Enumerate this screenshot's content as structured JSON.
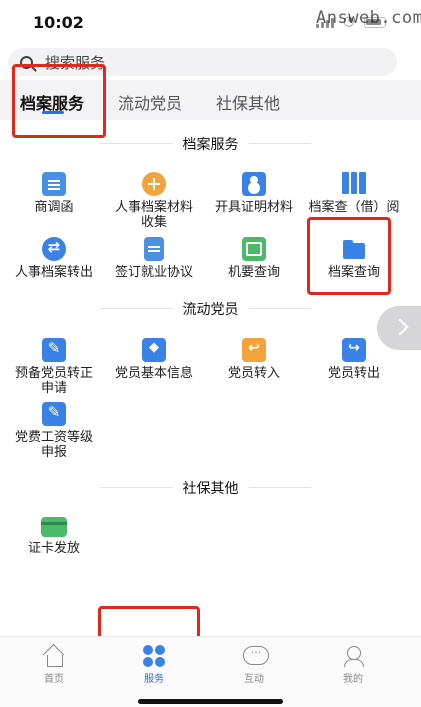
{
  "status_bar": {
    "time": "10:02"
  },
  "watermark": "Answeb.com",
  "search": {
    "placeholder": "搜索服务"
  },
  "tabs": [
    {
      "label": "档案服务",
      "active": true
    },
    {
      "label": "流动党员",
      "active": false
    },
    {
      "label": "社保其他",
      "active": false
    }
  ],
  "sections": [
    {
      "title": "档案服务",
      "items": [
        {
          "label": "商调函",
          "icon": "document-icon"
        },
        {
          "label": "人事档案材料收集",
          "icon": "plus-circle-icon"
        },
        {
          "label": "开具证明材料",
          "icon": "person-card-icon"
        },
        {
          "label": "档案查（借）阅",
          "icon": "file-cabinet-icon"
        },
        {
          "label": "人事档案转出",
          "icon": "transfer-icon"
        },
        {
          "label": "签订就业协议",
          "icon": "sheet-icon"
        },
        {
          "label": "机要查询",
          "icon": "envelope-icon"
        },
        {
          "label": "档案查询",
          "icon": "folder-icon"
        }
      ]
    },
    {
      "title": "流动党员",
      "items": [
        {
          "label": "预备党员转正申请",
          "icon": "edit-card-icon"
        },
        {
          "label": "党员基本信息",
          "icon": "layers-icon"
        },
        {
          "label": "党员转入",
          "icon": "transfer-in-icon"
        },
        {
          "label": "党员转出",
          "icon": "transfer-out-icon"
        },
        {
          "label": "党费工资等级申报",
          "icon": "pen-icon"
        }
      ]
    },
    {
      "title": "社保其他",
      "items": [
        {
          "label": "证卡发放",
          "icon": "card-icon"
        }
      ]
    }
  ],
  "tab_bar": [
    {
      "label": "首页",
      "icon": "home-icon",
      "active": false
    },
    {
      "label": "服务",
      "icon": "grid-icon",
      "active": true
    },
    {
      "label": "互动",
      "icon": "chat-icon",
      "active": false
    },
    {
      "label": "我的",
      "icon": "profile-icon",
      "active": false
    }
  ],
  "colors": {
    "accent": "#2e6be6",
    "highlight": "#e0281e",
    "orange": "#f2a33a",
    "green": "#4cb86a"
  }
}
